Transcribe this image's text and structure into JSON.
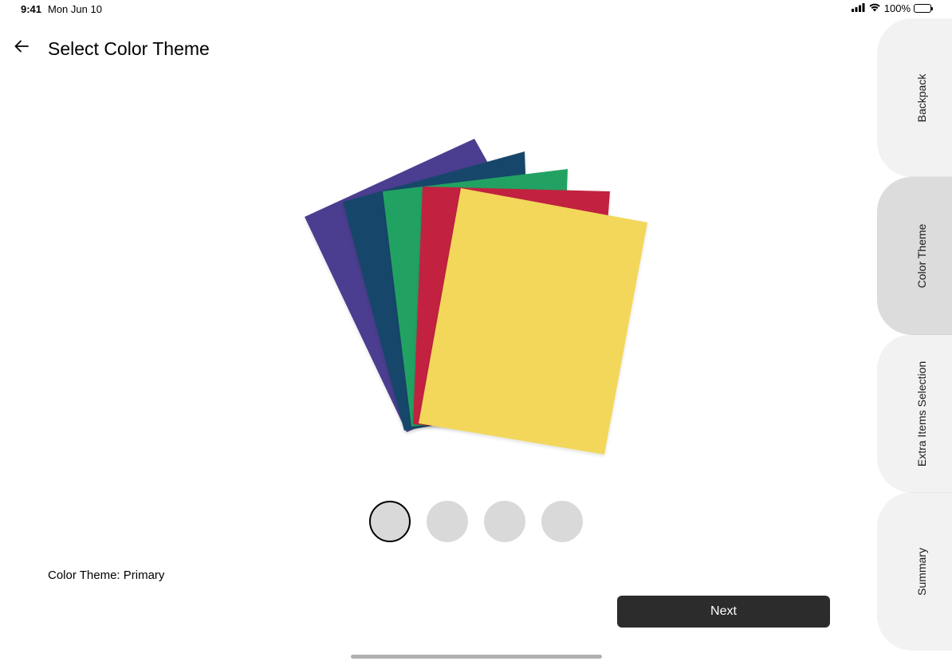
{
  "status_bar": {
    "time": "9:41",
    "date": "Mon Jun 10",
    "battery": "100%",
    "icons": [
      "signal-icon",
      "wifi-icon",
      "battery-icon"
    ]
  },
  "header": {
    "title": "Select Color Theme",
    "back_icon": "arrow-left-icon"
  },
  "hero": {
    "subject": "fanned folders",
    "folder_colors": [
      "#4b3c8f",
      "#17466b",
      "#22a262",
      "#c2223f",
      "#f2d75a"
    ]
  },
  "swatches": {
    "count": 4,
    "selected_index": 0,
    "fill_color": "#d9d9d9"
  },
  "selection": {
    "label": "Color Theme: Primary"
  },
  "actions": {
    "next_label": "Next"
  },
  "side_tabs": {
    "items": [
      {
        "label": "Backpack",
        "active": false
      },
      {
        "label": "Color Theme",
        "active": true
      },
      {
        "label": "Extra Items Selection",
        "active": false
      },
      {
        "label": "Summary",
        "active": false
      }
    ]
  },
  "colors": {
    "button_bg": "#2c2c2c",
    "tab_bg": "#f2f2f2",
    "tab_active_bg": "#dcdcdc"
  }
}
